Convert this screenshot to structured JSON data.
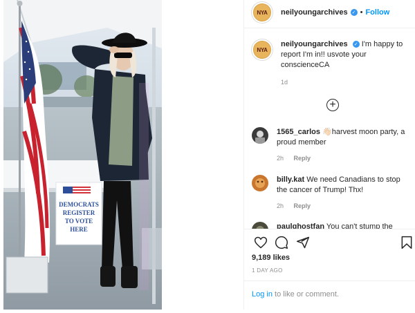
{
  "post": {
    "username": "neilyoungarchives",
    "avatar_text": "NYA",
    "follow_label": "Follow",
    "separator": "•",
    "caption": "I'm happy to report I'm in!! usvote your conscienceCA",
    "caption_age": "1d",
    "load_more_icon": "plus-circle-icon"
  },
  "photo": {
    "sign_line1": "DEMOCRATS",
    "sign_line2": "REGISTER",
    "sign_line3": "TO VOTE",
    "sign_line4": "HERE"
  },
  "comments": [
    {
      "username": "1565_carlos",
      "text": "👋🏻harvest moon party, a proud member",
      "age": "2h",
      "reply_label": "Reply"
    },
    {
      "username": "billy.kat",
      "text": "We need Canadians to stop the cancer of Trump! Thx!",
      "age": "2h",
      "reply_label": "Reply"
    },
    {
      "username": "paulghostfan",
      "text": "You can't stump the",
      "age": "",
      "reply_label": ""
    }
  ],
  "actions": {
    "like_icon": "heart-icon",
    "comment_icon": "comment-bubble-icon",
    "share_icon": "paper-plane-icon",
    "save_icon": "bookmark-icon"
  },
  "stats": {
    "likes": "9,189 likes",
    "posted_ago": "1 DAY AGO"
  },
  "login_prompt": {
    "link": "Log in",
    "rest": " to like or comment."
  },
  "colors": {
    "link_blue": "#0095f6",
    "verified_blue": "#3897f0",
    "muted_text": "#8e8e8e",
    "text": "#262626"
  }
}
